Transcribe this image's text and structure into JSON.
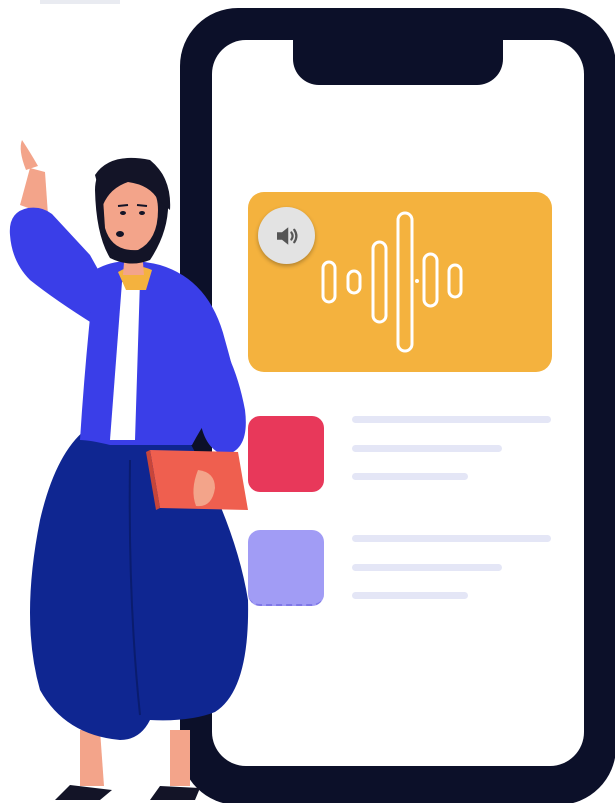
{
  "scene": {
    "colors": {
      "phone_frame": "#0c1029",
      "phone_screen": "#ffffff",
      "audio_card": "#f4b23e",
      "speaker_button": "#e3e3e3",
      "tile_red": "#e8385a",
      "tile_purple": "#a19cf5",
      "placeholder_line": "#e4e6f6",
      "jacket": "#3a3ee8",
      "pants": "#0f2691",
      "skin": "#f3a48a",
      "hair": "#131427",
      "book": "#ef5f4f"
    },
    "icons": {
      "speaker": "speaker-volume-icon",
      "waveform": "audio-waveform-icon"
    }
  }
}
